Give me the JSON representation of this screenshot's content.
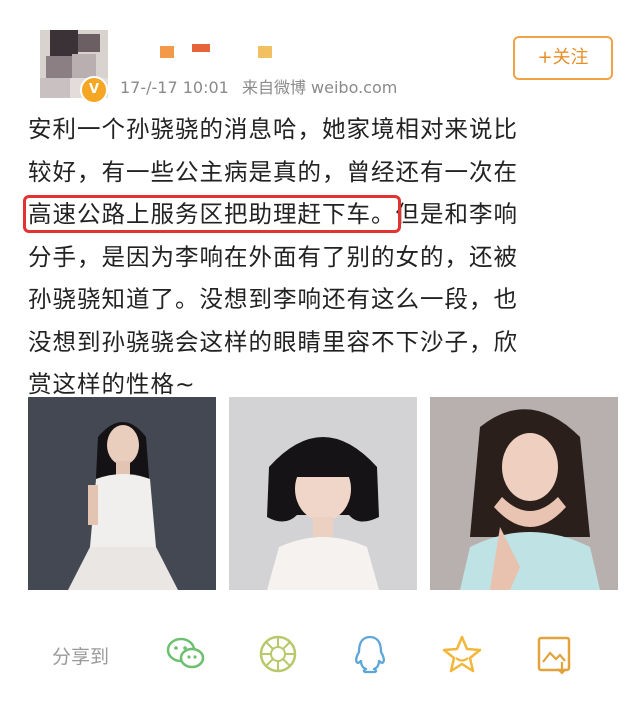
{
  "post": {
    "timestamp": "17-/-17 10:01",
    "source": "来自微博 weibo.com",
    "follow_label": "+关注",
    "verified_badge": "V",
    "text_lines": [
      "安利一个孙骁骁的消息哈，她家境相对来说比",
      "较好，有一些公主病是真的，曾经还有一次在",
      "高速公路上服务区把助理赶下车。",
      "但是和李响",
      "分手，是因为李响在外面有了别的女的，还被",
      "孙骁骁知道了。没想到李响还有这么一段，也",
      "没想到孙骁骁会这样的眼睛里容不下沙子，欣",
      "赏这样的性格~"
    ],
    "highlight_color": "#e23232",
    "accent_color": "#f0a247"
  },
  "photos": [
    {
      "name": "photo-1"
    },
    {
      "name": "photo-2"
    },
    {
      "name": "photo-3"
    }
  ],
  "share": {
    "label": "分享到",
    "icons": [
      "wechat-icon",
      "moments-icon",
      "qq-icon",
      "favorite-star-icon",
      "save-image-icon"
    ],
    "icon_color": "#6cc070"
  }
}
